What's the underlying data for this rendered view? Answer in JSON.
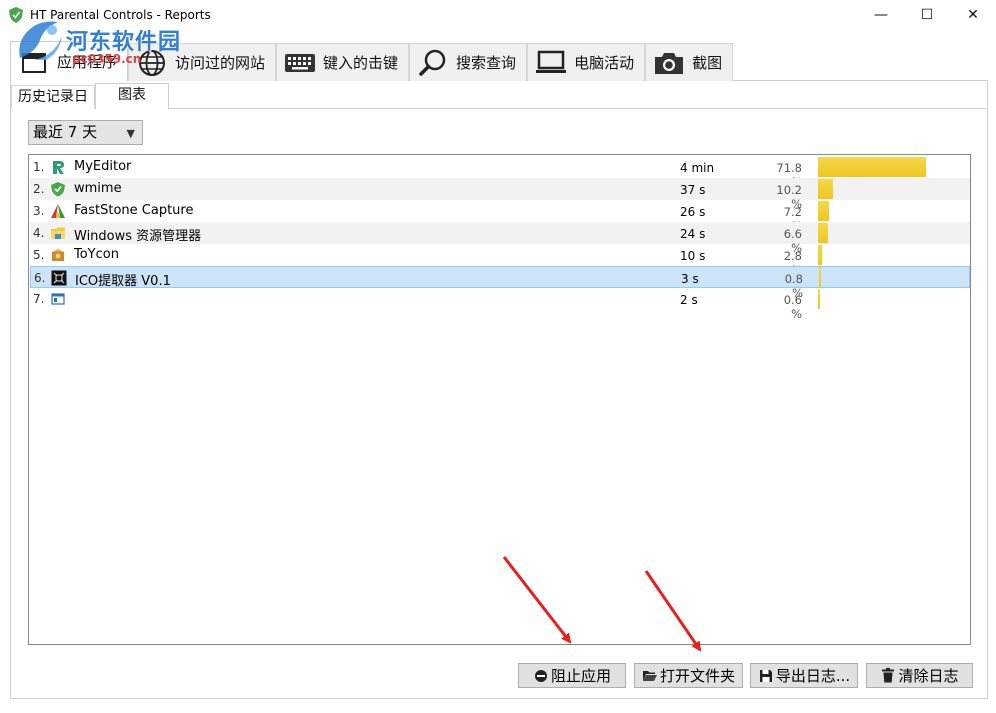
{
  "window": {
    "title": "HT Parental Controls - Reports",
    "minimize_glyph": "—",
    "maximize_glyph": "☐",
    "close_glyph": "✕"
  },
  "watermark": {
    "name": "河东软件园",
    "url": "pc0359.cn"
  },
  "main_tabs": [
    {
      "label": "应用程序",
      "icon": "applications-icon",
      "active": true
    },
    {
      "label": "访问过的网站",
      "icon": "globe-icon",
      "active": false
    },
    {
      "label": "键入的击键",
      "icon": "keyboard-icon",
      "active": false
    },
    {
      "label": "搜索查询",
      "icon": "magnifier-icon",
      "active": false
    },
    {
      "label": "电脑活动",
      "icon": "laptop-icon",
      "active": false
    },
    {
      "label": "截图",
      "icon": "camera-icon",
      "active": false
    }
  ],
  "sub_tabs": [
    {
      "label": "历史记录日",
      "active": false
    },
    {
      "label": "图表",
      "active": true
    }
  ],
  "period_select": {
    "value": "最近 7 天",
    "chevron": "▼"
  },
  "app_list": [
    {
      "rank": "1.",
      "name": "MyEditor",
      "time": "4 min",
      "percent": "71.8 %",
      "share": 71.8,
      "icon": "myeditor-icon"
    },
    {
      "rank": "2.",
      "name": "wmime",
      "time": "37 s",
      "percent": "10.2 %",
      "share": 10.2,
      "icon": "shield-icon"
    },
    {
      "rank": "3.",
      "name": "FastStone Capture",
      "time": "26 s",
      "percent": "7.2 %",
      "share": 7.2,
      "icon": "faststone-icon"
    },
    {
      "rank": "4.",
      "name": "Windows 资源管理器",
      "time": "24 s",
      "percent": "6.6 %",
      "share": 6.6,
      "icon": "folder-icon"
    },
    {
      "rank": "5.",
      "name": "ToYcon",
      "time": "10 s",
      "percent": "2.8 %",
      "share": 2.8,
      "icon": "toycon-icon"
    },
    {
      "rank": "6.",
      "name": "ICO提取器 V0.1",
      "time": "3 s",
      "percent": "0.8 %",
      "share": 0.8,
      "icon": "ico-extractor-icon",
      "selected": true
    },
    {
      "rank": "7.",
      "name": "",
      "time": "2 s",
      "percent": "0.6 %",
      "share": 0.6,
      "icon": "window-icon"
    }
  ],
  "buttons": {
    "block_app": "阻止应用",
    "open_folder": "打开文件夹",
    "export_log": "导出日志...",
    "clear_log": "清除日志"
  },
  "colors": {
    "bar": "#eec61e",
    "selection": "#cce4f7",
    "arrow": "#e8201c"
  }
}
